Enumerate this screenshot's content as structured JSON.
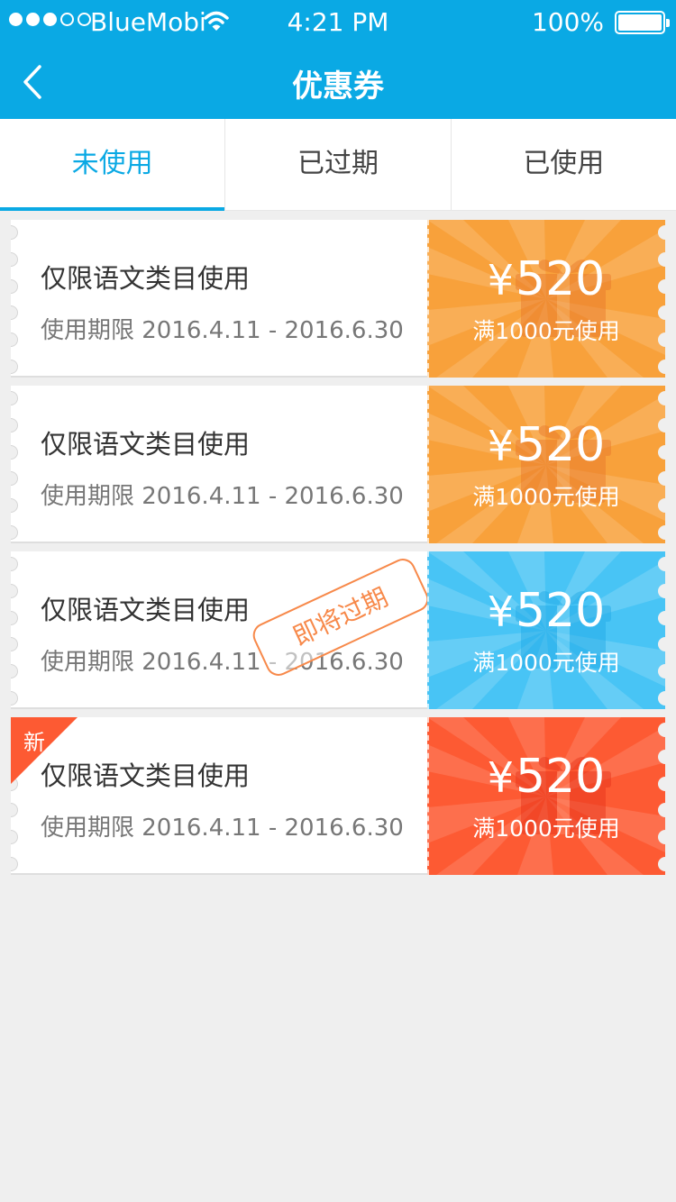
{
  "status_bar": {
    "carrier": "BlueMobi",
    "time": "4:21 PM",
    "battery": "100%"
  },
  "nav": {
    "title": "优惠券",
    "back_icon": "chevron-left-icon"
  },
  "tabs": [
    {
      "label": "未使用",
      "active": true
    },
    {
      "label": "已过期",
      "active": false
    },
    {
      "label": "已使用",
      "active": false
    }
  ],
  "coupons": [
    {
      "title": "仅限语文类目使用",
      "date": "使用期限 2016.4.11 - 2016.6.30",
      "currency": "¥",
      "amount": "520",
      "condition": "满1000元使用",
      "color": "#f8a13b"
    },
    {
      "title": "仅限语文类目使用",
      "date": "使用期限 2016.4.11 - 2016.6.30",
      "currency": "¥",
      "amount": "520",
      "condition": "满1000元使用",
      "color": "#f8a13b"
    },
    {
      "title": "仅限语文类目使用",
      "date": "使用期限 2016.4.11 - 2016.6.30",
      "currency": "¥",
      "amount": "520",
      "condition": "满1000元使用",
      "color": "#48c4f5",
      "stamp": "即将过期"
    },
    {
      "title": "仅限语文类目使用",
      "date": "使用期限 2016.4.11 - 2016.6.30",
      "currency": "¥",
      "amount": "520",
      "condition": "满1000元使用",
      "color": "#fd5a33",
      "badge": "新"
    }
  ],
  "colors": {
    "primary": "#0aa9e4",
    "badge": "#fd5a33",
    "stamp": "#f7894a"
  }
}
